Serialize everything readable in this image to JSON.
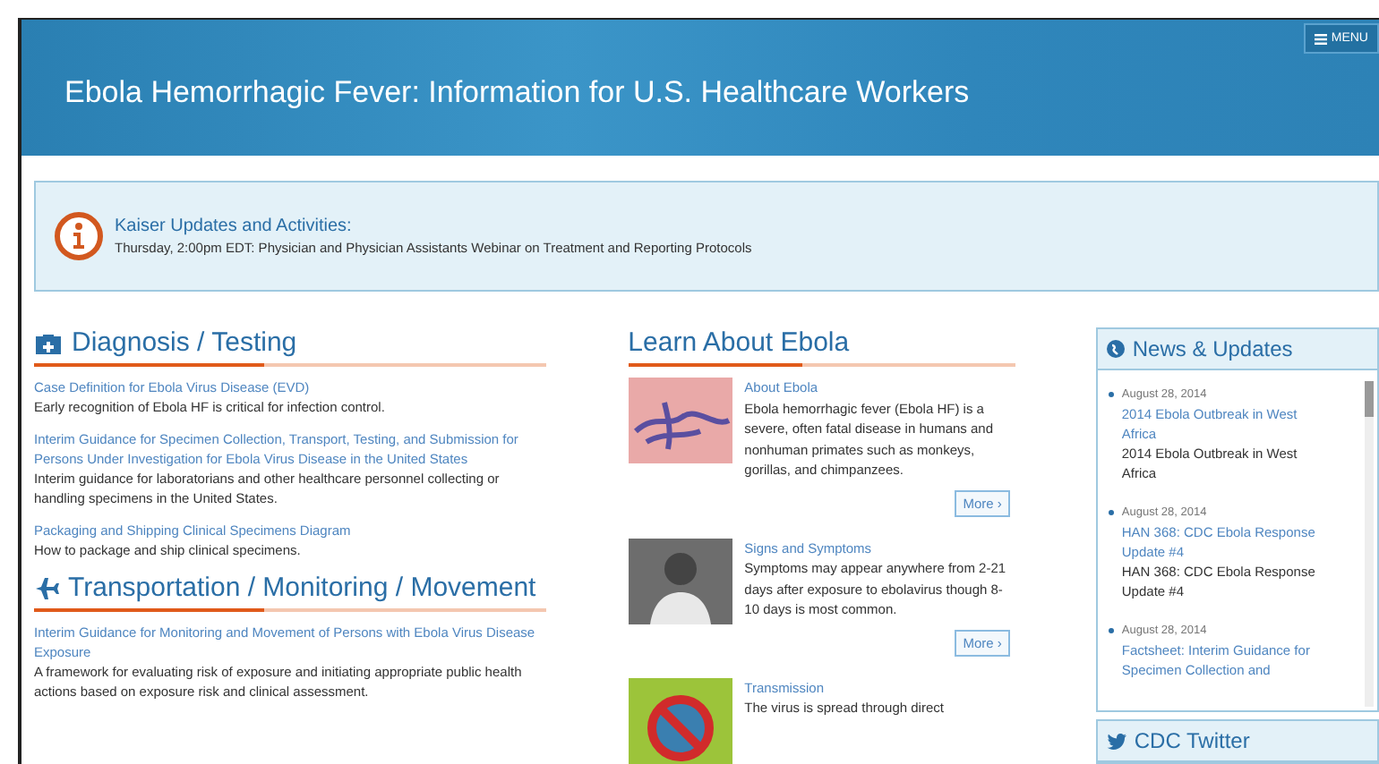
{
  "header": {
    "title": "Ebola Hemorrhagic Fever: Information for U.S. Healthcare Workers",
    "menu_label": "MENU"
  },
  "alert": {
    "title": "Kaiser Updates and Activities:",
    "text": "Thursday, 2:00pm EDT: Physician and Physician Assistants Webinar on Treatment and Reporting Protocols"
  },
  "sections": [
    {
      "kind": "kit",
      "title": "Diagnosis / Testing",
      "items": [
        {
          "link": "Case Definition for Ebola Virus Disease (EVD)",
          "text": "Early recognition of Ebola HF is critical for infection control."
        },
        {
          "link": "Interim Guidance for Specimen Collection, Transport, Testing, and Submission for Persons Under Investigation for Ebola Virus Disease in the United States",
          "text": "Interim guidance for laboratorians and other healthcare personnel collecting or handling specimens in the United States."
        },
        {
          "link": "Packaging and Shipping Clinical Specimens Diagram",
          "text": "How to package and ship clinical specimens."
        }
      ]
    },
    {
      "kind": "plane",
      "title": "Transportation / Monitoring / Movement",
      "items": [
        {
          "link": "Interim Guidance for Monitoring and Movement of Persons with Ebola Virus Disease Exposure",
          "text": "A framework for evaluating risk of exposure and initiating appropriate public health actions based on exposure risk and clinical assessment."
        }
      ]
    }
  ],
  "learn": {
    "title": "Learn About Ebola",
    "items": [
      {
        "kind": "virus",
        "link": "About Ebola",
        "text": "Ebola hemorrhagic fever (Ebola HF) is a severe, often fatal disease in humans and nonhuman primates such as monkeys, gorillas, and chimpanzees.",
        "button": "More ›"
      },
      {
        "kind": "person",
        "link": "Signs and Symptoms",
        "text": "Symptoms may appear anywhere from 2-21 days after exposure to ebolavirus though 8-10 days is most common.",
        "button": "More ›"
      },
      {
        "kind": "prohibited",
        "link": "Transmission",
        "text": "The virus is spread through direct"
      }
    ]
  },
  "news": {
    "title": "News & Updates",
    "items": [
      {
        "date": "August 28, 2014",
        "link": "2014 Ebola Outbreak in West Africa",
        "text": "2014 Ebola Outbreak in West Africa"
      },
      {
        "date": "August 28, 2014",
        "link": "HAN 368: CDC Ebola Response Update #4",
        "text": "HAN 368: CDC Ebola Response Update #4"
      },
      {
        "date": "August 28, 2014",
        "link": "Factsheet: Interim Guidance for Specimen Collection and"
      }
    ]
  },
  "twitter": {
    "title": "CDC Twitter"
  }
}
